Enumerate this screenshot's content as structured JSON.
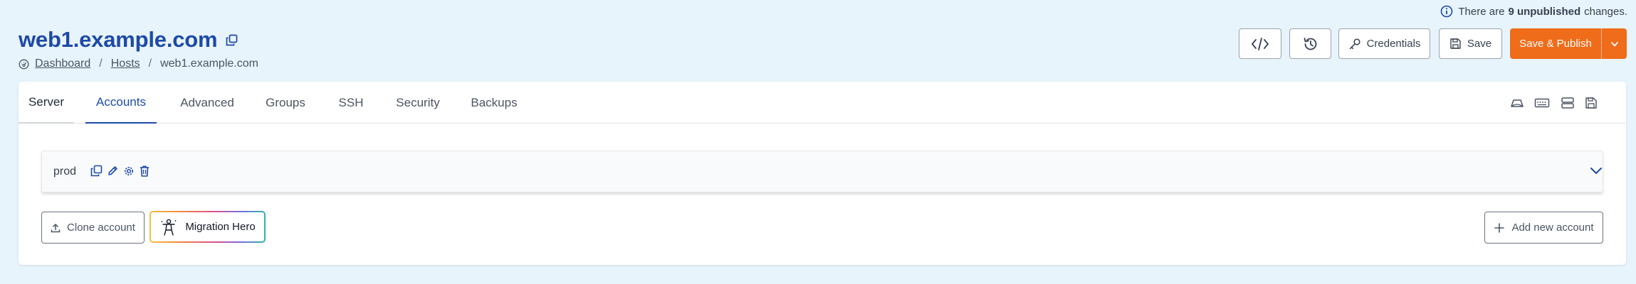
{
  "notice": {
    "prefix": "There are",
    "highlight": "9 unpublished",
    "suffix": "changes."
  },
  "page": {
    "title": "web1.example.com"
  },
  "breadcrumb": {
    "items": [
      "Dashboard",
      "Hosts",
      "web1.example.com"
    ],
    "separator": "/"
  },
  "toolbar": {
    "credentials_label": "Credentials",
    "save_label": "Save",
    "publish_label": "Save & Publish"
  },
  "tabs": [
    {
      "label": "Server"
    },
    {
      "label": "Accounts"
    },
    {
      "label": "Advanced"
    },
    {
      "label": "Groups"
    },
    {
      "label": "SSH"
    },
    {
      "label": "Security"
    },
    {
      "label": "Backups"
    }
  ],
  "active_tab": "Accounts",
  "account": {
    "name": "prod",
    "expanded": false
  },
  "actions": {
    "clone_label": "Clone account",
    "hero_label": "Migration Hero",
    "add_label": "Add new account"
  },
  "colors": {
    "page_bg": "#e8f4fc",
    "brand_blue": "#1d4aa8",
    "publish_orange": "#ef6c1a"
  },
  "icons": {
    "notice": "info-icon",
    "copy_title": "copy-icon",
    "dashboard": "dashboard-icon",
    "code": "code-icon",
    "history": "history-icon",
    "credentials": "key-icon",
    "save": "floppy-icon",
    "publish_dropdown": "chevron-down-icon",
    "tab_right": [
      "cloud-icon",
      "keyboard-icon",
      "server-icon",
      "floppy-icon"
    ],
    "account_actions": [
      "copy-icon",
      "pencil-icon",
      "gear-icon",
      "trash-icon"
    ],
    "clone": "upload-icon",
    "hero": "hero-figure-icon",
    "add": "plus-icon"
  }
}
